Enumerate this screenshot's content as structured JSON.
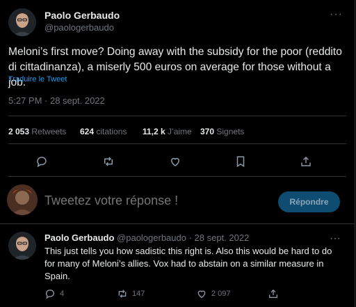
{
  "tweet": {
    "author_name": "Paolo Gerbaudo",
    "author_handle": "@paologerbaudo",
    "text": "Meloni’s first move? Doing away with the subsidy for the poor (reddito di cittadinanza), a miserly 500 euros on average for those without a job.",
    "translate_label": "Traduire le Tweet",
    "timestamp": "5:27 PM · 28 sept. 2022",
    "more_label": "···",
    "stats": {
      "retweets_count": "2 053",
      "retweets_label": "Retweets",
      "quotes_count": "624",
      "quotes_label": "citations",
      "likes_count": "11,2 k",
      "likes_label": "J’aime",
      "bookmarks_count": "370",
      "bookmarks_label": "Signets"
    },
    "action_icons": [
      "reply-icon",
      "retweet-icon",
      "like-icon",
      "bookmark-icon",
      "share-icon"
    ]
  },
  "composer": {
    "placeholder": "Tweetez votre réponse !",
    "reply_button_label": "Répondre"
  },
  "reply": {
    "author_name": "Paolo Gerbaudo",
    "meta": "@paologerbaudo · 28 sept. 2022",
    "more_label": "···",
    "text": "This just tells you how sadistic this right is. Also this would be hard to do for many of Meloni’s allies. Vox had to abstain on a similar measure in Spain.",
    "reply_count": "4",
    "retweet_count": "147",
    "like_count": "2 097"
  },
  "colors": {
    "background": "#000000",
    "text": "#e7e9ea",
    "muted": "#71767b",
    "accent": "#1d9bf0",
    "divider": "#2f3336"
  }
}
